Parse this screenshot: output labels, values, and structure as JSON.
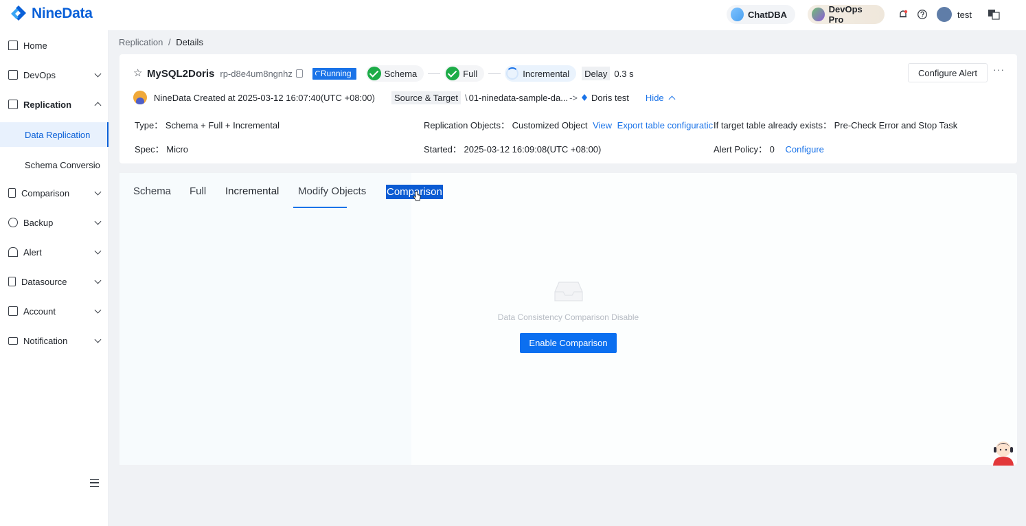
{
  "app": {
    "name": "NineData"
  },
  "topbar": {
    "chatdba": "ChatDBA",
    "devops_pro": "DevOps Pro",
    "user": "test"
  },
  "sidebar": {
    "items": [
      {
        "label": "Home"
      },
      {
        "label": "DevOps"
      },
      {
        "label": "Replication"
      },
      {
        "label": "Comparison"
      },
      {
        "label": "Backup"
      },
      {
        "label": "Alert"
      },
      {
        "label": "Datasource"
      },
      {
        "label": "Account"
      },
      {
        "label": "Notification"
      }
    ],
    "sub_items": [
      {
        "label": "Data Replication"
      },
      {
        "label": "Schema Conversio"
      }
    ]
  },
  "breadcrumb": {
    "parent": "Replication",
    "sep": "/",
    "current": "Details"
  },
  "task": {
    "name": "MySQL2Doris",
    "id": "rp-d8e4um8ngnhz",
    "status": "Running",
    "steps": [
      "Schema",
      "Full",
      "Incremental"
    ],
    "delay_label": "Delay",
    "delay_value": "0.3 s",
    "configure_alert": "Configure Alert",
    "more": "···",
    "created": "NineData Created at 2025-03-12 16:07:40(UTC +08:00)",
    "source_target_label": "Source & Target",
    "source": "01-ninedata-sample-da...",
    "arrow": "->",
    "target": "Doris test",
    "hide": "Hide",
    "type_label": "Type：",
    "type_value": "Schema + Full + Incremental",
    "spec_label": "Spec：",
    "spec_value": "Micro",
    "objects_label": "Replication Objects：",
    "objects_value": "Customized Object",
    "view_link": "View",
    "export_link": "Export table configuratic",
    "started_label": "Started：",
    "started_value": "2025-03-12 16:09:08(UTC +08:00)",
    "exists_label": "If target table already exists：",
    "exists_value": "Pre-Check Error and Stop Task",
    "alert_policy_label": "Alert Policy：",
    "alert_policy_value": "0",
    "configure_link": "Configure"
  },
  "tabs": [
    "Schema",
    "Full",
    "Incremental",
    "Modify Objects",
    "Comparison"
  ],
  "empty": {
    "message": "Data Consistency Comparison Disable",
    "button": "Enable Comparison"
  },
  "colors": {
    "brand": "#0a60d8",
    "accent": "#1a73e8",
    "success": "#1dac48"
  }
}
